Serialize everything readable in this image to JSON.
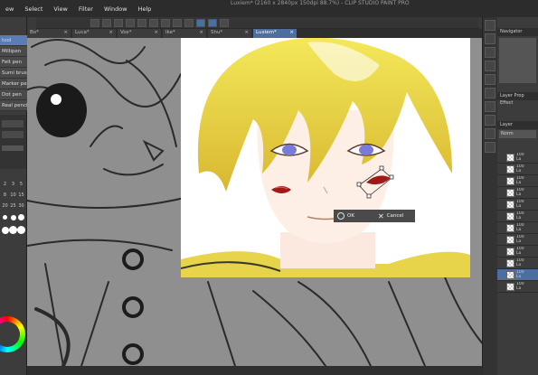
{
  "app": {
    "title": "Luxiem* (2160 x 2840px 150dpi 88.7%) - CLIP STUDIO PAINT PRO"
  },
  "menu": [
    "ew",
    "Select",
    "View",
    "Filter",
    "Window",
    "Help"
  ],
  "tabs": [
    {
      "label": "Bo*",
      "active": false
    },
    {
      "label": "Luca*",
      "active": false
    },
    {
      "label": "Vox*",
      "active": false
    },
    {
      "label": "Ike*",
      "active": false
    },
    {
      "label": "Shu*",
      "active": false
    },
    {
      "label": "Luxiem*",
      "active": true
    }
  ],
  "left_panel": {
    "sub_tools": [
      "tool",
      "Millipen",
      "Felt pen",
      "Sumi brush",
      "Marker pen",
      "Dot pen",
      "Real pencil"
    ],
    "selected_index": 0,
    "brush_sizes": [
      "2",
      "3",
      "5",
      "8",
      "10",
      "15",
      "20",
      "25",
      "30"
    ]
  },
  "confirm": {
    "ok_label": "OK",
    "cancel_label": "Cancel"
  },
  "right_panel": {
    "navigator_label": "Navigator",
    "layer_property_label": "Layer Prop",
    "effect_label": "Effect",
    "layer_label": "Layer",
    "blend_mode": "Norm",
    "layers": [
      {
        "opacity": "100",
        "name": "La"
      },
      {
        "opacity": "100",
        "name": "La"
      },
      {
        "opacity": "100",
        "name": "La"
      },
      {
        "opacity": "100",
        "name": "La"
      },
      {
        "opacity": "100",
        "name": "La"
      },
      {
        "opacity": "100",
        "name": "La"
      },
      {
        "opacity": "100",
        "name": "La"
      },
      {
        "opacity": "100",
        "name": "La"
      },
      {
        "opacity": "100",
        "name": "La"
      },
      {
        "opacity": "100",
        "name": "La"
      },
      {
        "opacity": "100",
        "name": "La"
      },
      {
        "opacity": "100",
        "name": "La"
      }
    ]
  },
  "colors": {
    "accent": "#4d6fa0",
    "hair": "#f2e35a",
    "lips": "#a01818",
    "eyes": "#7a7ad8",
    "jacket": "#e8d44a"
  }
}
